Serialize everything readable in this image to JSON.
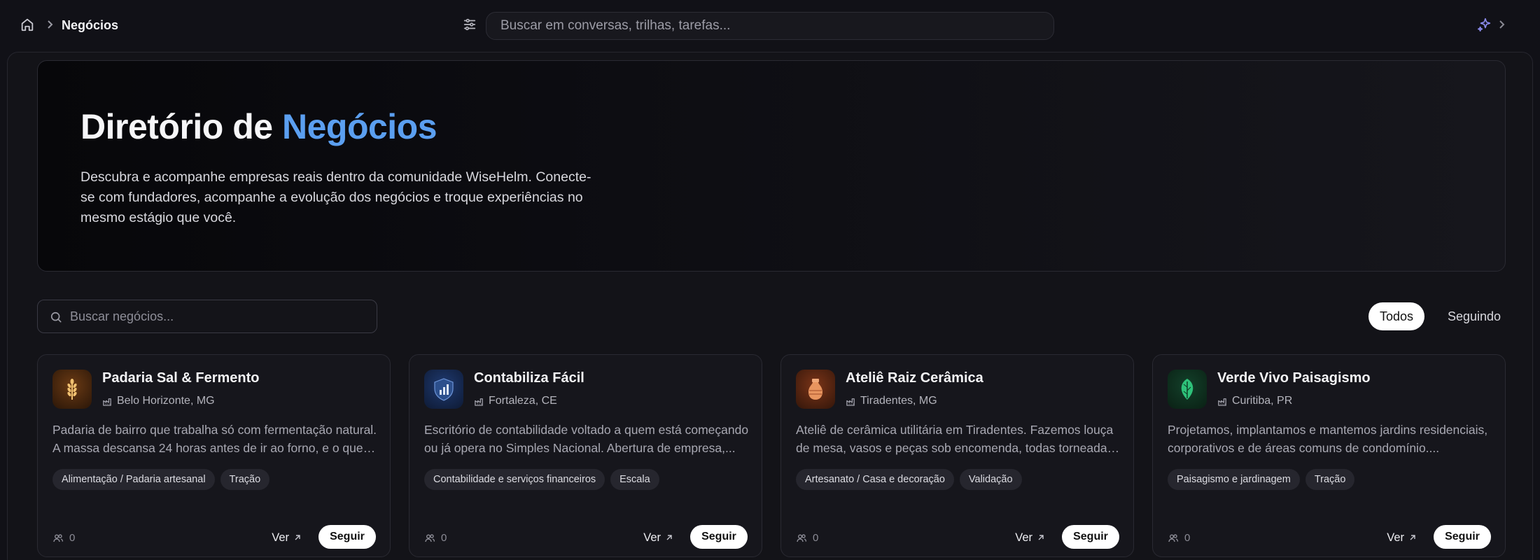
{
  "header": {
    "breadcrumb_title": "Negócios",
    "search_placeholder": "Buscar em conversas, trilhas, tarefas..."
  },
  "hero": {
    "title_prefix": "Diretório de ",
    "title_accent": "Negócios",
    "description": "Descubra e acompanhe empresas reais dentro da comunidade WiseHelm. Conecte-se com fundadores, acompanhe a evolução dos negócios e troque experiências no mesmo estágio que você.",
    "accent_color": "#5b9ff0"
  },
  "filters": {
    "search_placeholder": "Buscar negócios...",
    "tab_all": "Todos",
    "tab_following": "Seguindo",
    "active_tab": "Todos"
  },
  "cards": [
    {
      "name": "Padaria Sal & Fermento",
      "location": "Belo Horizonte, MG",
      "description": "Padaria de bairro que trabalha só com fermentação natural. A massa descansa 24 horas antes de ir ao forno, e o que sai ...",
      "tags": [
        "Alimentação / Padaria artesanal",
        "Tração"
      ],
      "followers": "0",
      "view_label": "Ver",
      "follow_label": "Seguir",
      "logo_icon": "wheat-icon",
      "logo_color": "#3a2410"
    },
    {
      "name": "Contabiliza Fácil",
      "location": "Fortaleza, CE",
      "description": "Escritório de contabilidade voltado a quem está começando ou já opera no Simples Nacional. Abertura de empresa,...",
      "tags": [
        "Contabilidade e serviços financeiros",
        "Escala"
      ],
      "followers": "0",
      "view_label": "Ver",
      "follow_label": "Seguir",
      "logo_icon": "shield-chart-icon",
      "logo_color": "#13203a"
    },
    {
      "name": "Ateliê Raiz Cerâmica",
      "location": "Tiradentes, MG",
      "description": "Ateliê de cerâmica utilitária em Tiradentes. Fazemos louça de mesa, vasos e peças sob encomenda, todas torneadas e...",
      "tags": [
        "Artesanato / Casa e decoração",
        "Validação"
      ],
      "followers": "0",
      "view_label": "Ver",
      "follow_label": "Seguir",
      "logo_icon": "vase-icon",
      "logo_color": "#3a1a10"
    },
    {
      "name": "Verde Vivo Paisagismo",
      "location": "Curitiba, PR",
      "description": "Projetamos, implantamos e mantemos jardins residenciais, corporativos e de áreas comuns de condomínio....",
      "tags": [
        "Paisagismo e jardinagem",
        "Tração"
      ],
      "followers": "0",
      "view_label": "Ver",
      "follow_label": "Seguir",
      "logo_icon": "leaf-icon",
      "logo_color": "#0f2a1c"
    }
  ]
}
